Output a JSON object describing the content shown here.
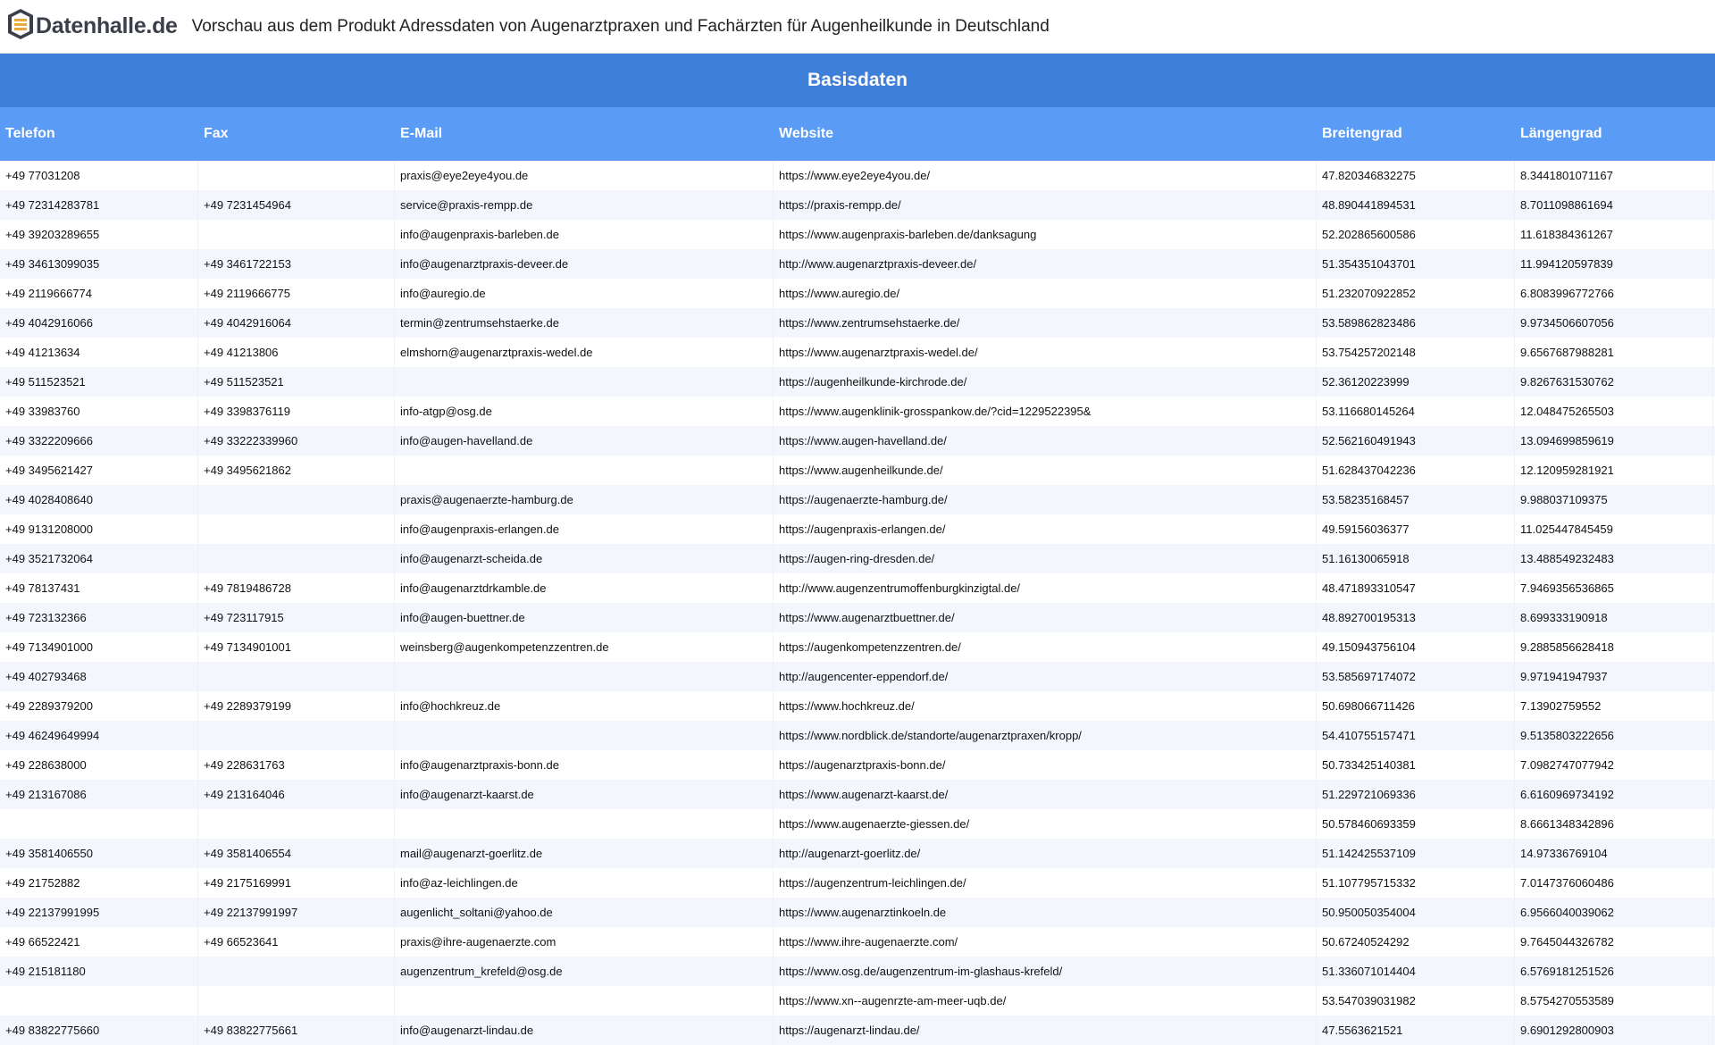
{
  "header": {
    "logo_text": "Datenhalle.de",
    "title": "Vorschau aus dem Produkt Adressdaten von Augenarztpraxen und Fachärzten für Augenheilkunde in Deutschland"
  },
  "section": {
    "title": "Basisdaten"
  },
  "columns": [
    "Telefon",
    "Fax",
    "E-Mail",
    "Website",
    "Breitengrad",
    "Längengrad"
  ],
  "rows": [
    [
      "+49 77031208",
      "",
      "praxis@eye2eye4you.de",
      "https://www.eye2eye4you.de/",
      "47.820346832275",
      "8.3441801071167"
    ],
    [
      "+49 72314283781",
      "+49 7231454964",
      "service@praxis-rempp.de",
      "https://praxis-rempp.de/",
      "48.890441894531",
      "8.7011098861694"
    ],
    [
      "+49 39203289655",
      "",
      "info@augenpraxis-barleben.de",
      "https://www.augenpraxis-barleben.de/danksagung",
      "52.202865600586",
      "11.618384361267"
    ],
    [
      "+49 34613099035",
      "+49 3461722153",
      "info@augenarztpraxis-deveer.de",
      "http://www.augenarztpraxis-deveer.de/",
      "51.354351043701",
      "11.994120597839"
    ],
    [
      "+49 2119666774",
      "+49 2119666775",
      "info@auregio.de",
      "https://www.auregio.de/",
      "51.232070922852",
      "6.8083996772766"
    ],
    [
      "+49 4042916066",
      "+49 4042916064",
      "termin@zentrumsehstaerke.de",
      "https://www.zentrumsehstaerke.de/",
      "53.589862823486",
      "9.9734506607056"
    ],
    [
      "+49 41213634",
      "+49 41213806",
      "elmshorn@augenarztpraxis-wedel.de",
      "https://www.augenarztpraxis-wedel.de/",
      "53.754257202148",
      "9.6567687988281"
    ],
    [
      "+49 511523521",
      "+49 511523521",
      "",
      "https://augenheilkunde-kirchrode.de/",
      "52.36120223999",
      "9.8267631530762"
    ],
    [
      "+49 33983760",
      "+49 3398376119",
      "info-atgp@osg.de",
      "https://www.augenklinik-grosspankow.de/?cid=1229522395&",
      "53.116680145264",
      "12.048475265503"
    ],
    [
      "+49 3322209666",
      "+49 33222339960",
      "info@augen-havelland.de",
      "https://www.augen-havelland.de/",
      "52.562160491943",
      "13.094699859619"
    ],
    [
      "+49 3495621427",
      "+49 3495621862",
      "",
      "https://www.augenheilkunde.de/",
      "51.628437042236",
      "12.120959281921"
    ],
    [
      "+49 4028408640",
      "",
      "praxis@augenaerzte-hamburg.de",
      "https://augenaerzte-hamburg.de/",
      "53.58235168457",
      "9.988037109375"
    ],
    [
      "+49 9131208000",
      "",
      "info@augenpraxis-erlangen.de",
      "https://augenpraxis-erlangen.de/",
      "49.59156036377",
      "11.025447845459"
    ],
    [
      "+49 3521732064",
      "",
      "info@augenarzt-scheida.de",
      "https://augen-ring-dresden.de/",
      "51.16130065918",
      "13.488549232483"
    ],
    [
      "+49 78137431",
      "+49 7819486728",
      "info@augenarztdrkamble.de",
      "http://www.augenzentrumoffenburgkinzigtal.de/",
      "48.471893310547",
      "7.9469356536865"
    ],
    [
      "+49 723132366",
      "+49 723117915",
      "info@augen-buettner.de",
      "https://www.augenarztbuettner.de/",
      "48.892700195313",
      "8.699333190918"
    ],
    [
      "+49 7134901000",
      "+49 7134901001",
      "weinsberg@augenkompetenzzentren.de",
      "https://augenkompetenzzentren.de/",
      "49.150943756104",
      "9.2885856628418"
    ],
    [
      "+49 402793468",
      "",
      "",
      "http://augencenter-eppendorf.de/",
      "53.585697174072",
      "9.971941947937"
    ],
    [
      "+49 2289379200",
      "+49 2289379199",
      "info@hochkreuz.de",
      "https://www.hochkreuz.de/",
      "50.698066711426",
      "7.13902759552"
    ],
    [
      "+49 46249649994",
      "",
      "",
      "https://www.nordblick.de/standorte/augenarztpraxen/kropp/",
      "54.410755157471",
      "9.5135803222656"
    ],
    [
      "+49 228638000",
      "+49 228631763",
      "info@augenarztpraxis-bonn.de",
      "https://augenarztpraxis-bonn.de/",
      "50.733425140381",
      "7.0982747077942"
    ],
    [
      "+49 213167086",
      "+49 213164046",
      "info@augenarzt-kaarst.de",
      "https://www.augenarzt-kaarst.de/",
      "51.229721069336",
      "6.6160969734192"
    ],
    [
      "",
      "",
      "",
      "https://www.augenaerzte-giessen.de/",
      "50.578460693359",
      "8.6661348342896"
    ],
    [
      "+49 3581406550",
      "+49 3581406554",
      "mail@augenarzt-goerlitz.de",
      "http://augenarzt-goerlitz.de/",
      "51.142425537109",
      "14.97336769104"
    ],
    [
      "+49 21752882",
      "+49 2175169991",
      "info@az-leichlingen.de",
      "https://augenzentrum-leichlingen.de/",
      "51.107795715332",
      "7.0147376060486"
    ],
    [
      "+49 22137991995",
      "+49 22137991997",
      "augenlicht_soltani@yahoo.de",
      "https://www.augenarztinkoeln.de",
      "50.950050354004",
      "6.9566040039062"
    ],
    [
      "+49 66522421",
      "+49 66523641",
      "praxis@ihre-augenaerzte.com",
      "https://www.ihre-augenaerzte.com/",
      "50.67240524292",
      "9.7645044326782"
    ],
    [
      "+49 215181180",
      "",
      "augenzentrum_krefeld@osg.de",
      "https://www.osg.de/augenzentrum-im-glashaus-krefeld/",
      "51.336071014404",
      "6.5769181251526"
    ],
    [
      "",
      "",
      "",
      "https://www.xn--augenrzte-am-meer-uqb.de/",
      "53.547039031982",
      "8.5754270553589"
    ],
    [
      "+49 83822775660",
      "+49 83822775661",
      "info@augenarzt-lindau.de",
      "https://augenarzt-lindau.de/",
      "47.5563621521",
      "9.6901292800903"
    ]
  ]
}
